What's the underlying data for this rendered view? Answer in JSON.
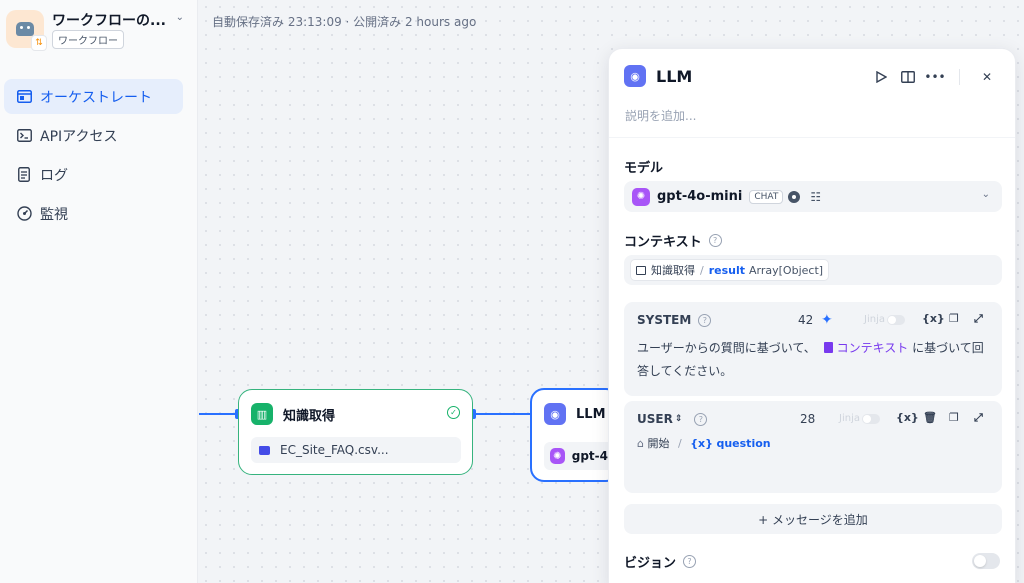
{
  "app": {
    "name": "ワークフローの...",
    "type": "ワークフロー"
  },
  "nav": {
    "items": [
      {
        "label": "オーケストレート",
        "icon": "layout-icon"
      },
      {
        "label": "APIアクセス",
        "icon": "terminal-icon"
      },
      {
        "label": "ログ",
        "icon": "document-icon"
      },
      {
        "label": "監視",
        "icon": "dashboard-icon"
      }
    ]
  },
  "canvas": {
    "status": "自動保存済み 23:13:09 · 公開済み 2 hours ago",
    "kb_node": {
      "title": "知識取得",
      "file": "EC_Site_FAQ.csv..."
    },
    "llm_node": {
      "title": "LLM",
      "model": "gpt-4"
    }
  },
  "panel": {
    "title": "LLM",
    "description_placeholder": "説明を追加...",
    "model_label": "モデル",
    "model_name": "gpt-4o-mini",
    "model_tag": "CHAT",
    "context_label": "コンテキスト",
    "context_source": "知識取得",
    "context_var": "result",
    "context_type": "Array[Object]",
    "system": {
      "role": "SYSTEM",
      "count": "42",
      "jinja": "Jinja",
      "text_before": "ユーザーからの質問に基づいて、",
      "context_ref": "コンテキスト",
      "text_after": "に基づいて回答してください。"
    },
    "user": {
      "role": "USER",
      "count": "28",
      "jinja": "Jinja",
      "source": "開始",
      "var": "question"
    },
    "add_message": "+ メッセージを追加",
    "vision_label": "ビジョン"
  },
  "colors": {
    "accent": "#155eef",
    "edge": "#2970ff",
    "kb_green": "#17b26a"
  }
}
